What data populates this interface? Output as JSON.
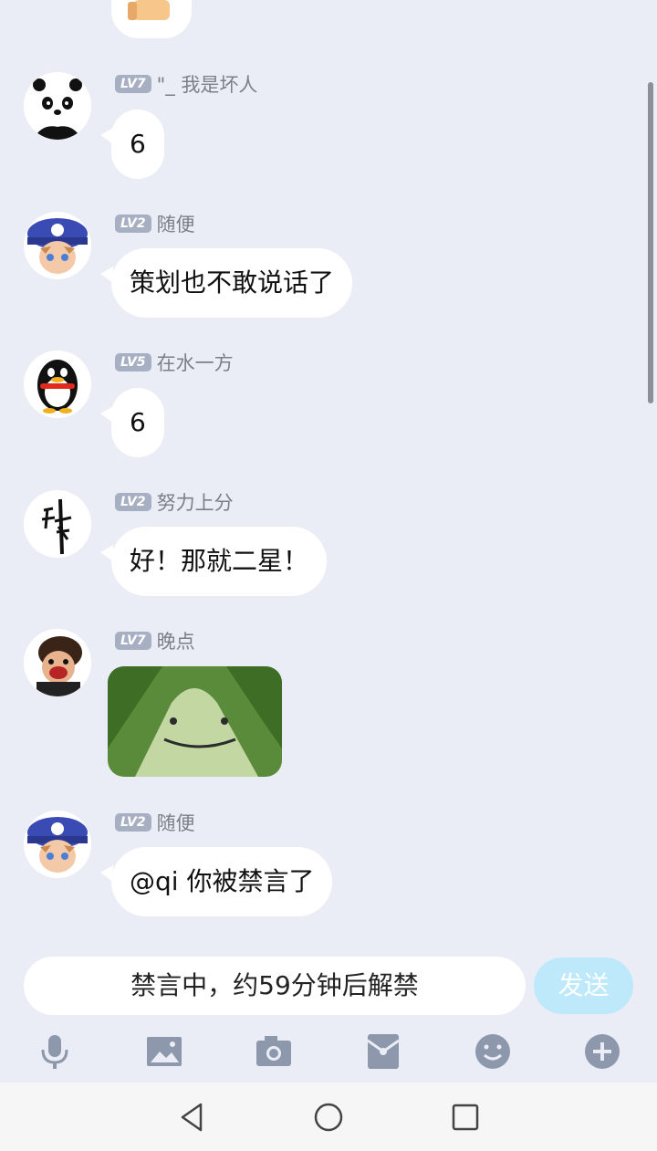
{
  "messages": [
    {
      "level": "LV7",
      "name": "\"_ 我是坏人",
      "text": "6"
    },
    {
      "level": "LV2",
      "name": "随便",
      "text": "策划也不敢说话了"
    },
    {
      "level": "LV5",
      "name": "在水一方",
      "text": "6"
    },
    {
      "level": "LV2",
      "name": "努力上分",
      "text": "好！那就二星！"
    },
    {
      "level": "LV7",
      "name": "晚点"
    },
    {
      "level": "LV2",
      "name": "随便",
      "text": "@qi 你被禁言了"
    }
  ],
  "input": {
    "muted_text": "禁言中，约59分钟后解禁",
    "send_label": "发送"
  },
  "toolbar": [
    "microphone-icon",
    "image-icon",
    "camera-icon",
    "red-packet-icon",
    "emoji-icon",
    "plus-icon"
  ],
  "colors": {
    "background": "#eaedf5",
    "level_badge": "#a7afc2",
    "send_button": "#bde9fb"
  }
}
